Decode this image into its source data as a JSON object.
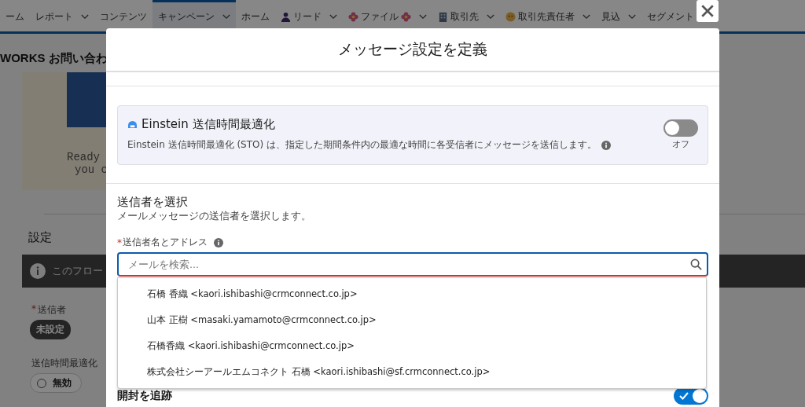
{
  "nav": {
    "tabs": [
      {
        "label": "ーム",
        "selected": false,
        "menu": false
      },
      {
        "label": "レポート",
        "selected": false,
        "menu": true
      },
      {
        "label": "コンテンツ",
        "selected": false,
        "menu": false
      },
      {
        "label": "キャンペーン",
        "selected": true,
        "menu": true
      },
      {
        "label": "ホーム",
        "selected": false,
        "menu": false
      },
      {
        "label": "リード",
        "selected": false,
        "menu": true
      },
      {
        "label": "ファイル",
        "selected": false,
        "menu": true
      },
      {
        "label": "取引先",
        "selected": false,
        "menu": true
      },
      {
        "label": "取引先責任者",
        "selected": false,
        "menu": true
      },
      {
        "label": "見込",
        "selected": false,
        "menu": true
      },
      {
        "label": "セグメント",
        "selected": false,
        "menu": false
      }
    ]
  },
  "page": {
    "title": "WORKS お問い合わ",
    "preview_lines": [
      "Ready",
      "you c"
    ],
    "settings_title": "設定",
    "notice": "このフロー",
    "sender_required_mark": "*",
    "sender_label": "送信者",
    "sender_badge": "未設定",
    "sto_label": "送信時間最適化",
    "sto_option": {
      "label": "無効",
      "selected": false
    }
  },
  "modal": {
    "title": "メッセージ設定を定義",
    "einstein": {
      "title": "Einstein 送信時間最適化",
      "description": "Einstein 送信時間最適化 (STO) は、指定した期間条件内の最適な時間に各受信者にメッセージを送信します。",
      "toggle": {
        "on": false,
        "label": "オフ"
      }
    },
    "sender": {
      "title": "送信者を選択",
      "subtitle": "メールメッセージの送信者を選択します。",
      "required_mark": "*",
      "field_label": "送信者名とアドレス",
      "placeholder": "メールを検索...",
      "options": [
        {
          "label": "石橋 香織 <kaori.ishibashi@crmconnect.co.jp>"
        },
        {
          "label": "山本 正樹 <masaki.yamamoto@crmconnect.co.jp>"
        },
        {
          "label": "石橋香織 <kaori.ishibashi@crmconnect.co.jp>"
        },
        {
          "label": "株式会社シーアールエムコネクト 石橋 <kaori.ishibashi@sf.crmconnect.co.jp>"
        }
      ]
    },
    "open_tracking": {
      "title": "開封を追跡",
      "on": true
    }
  }
}
